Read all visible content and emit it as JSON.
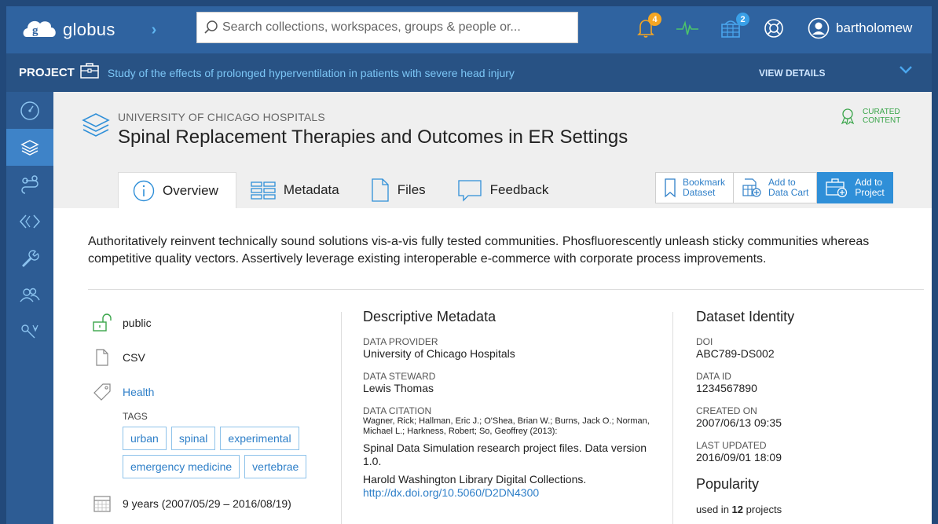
{
  "topbar": {
    "brand": "globus",
    "search_placeholder": "Search collections, workspaces, groups & people or...",
    "notifications_count": "4",
    "cart_count": "2",
    "username": "bartholomew"
  },
  "project": {
    "label": "PROJECT",
    "title": "Study of the effects of prolonged hyperventilation in patients with severe head injury",
    "view_details": "VIEW DETAILS"
  },
  "dataset": {
    "org": "UNIVERSITY OF CHICAGO HOSPITALS",
    "title": "Spinal Replacement Therapies and Outcomes in ER Settings",
    "curated_line1": "CURATED",
    "curated_line2": "CONTENT",
    "description": "Authoritatively reinvent technically sound solutions vis-a-vis fully tested communities. Phosfluorescently unleash sticky communities whereas competitive quality vectors. Assertively leverage existing interoperable e-commerce with corporate process improvements."
  },
  "tabs": [
    {
      "label": "Overview"
    },
    {
      "label": "Metadata"
    },
    {
      "label": "Files"
    },
    {
      "label": "Feedback"
    }
  ],
  "actions": {
    "bookmark_1": "Bookmark",
    "bookmark_2": "Dataset",
    "cart_1": "Add to",
    "cart_2": "Data Cart",
    "project_1": "Add to",
    "project_2": "Project"
  },
  "summary": {
    "access": "public",
    "format": "CSV",
    "category": "Health",
    "tags_label": "TAGS",
    "tags": [
      "urban",
      "spinal",
      "experimental",
      "emergency medicine",
      "vertebrae"
    ],
    "timespan": "9 years (2007/05/29 – 2016/08/19)"
  },
  "descriptive": {
    "heading": "Descriptive Metadata",
    "provider_label": "DATA PROVIDER",
    "provider": "University of Chicago Hospitals",
    "steward_label": "DATA STEWARD",
    "steward": "Lewis Thomas",
    "citation_label": "DATA CITATION",
    "citation_authors": "Wagner, Rick; Hallman, Eric J.; O'Shea, Brian W.; Burns, Jack O.; Norman, Michael L.; Harkness, Robert; So, Geoffrey (2013):",
    "citation_title": "Spinal Data Simulation research project files. Data version 1.0.",
    "citation_publisher": "Harold Washington Library Digital Collections.",
    "citation_url": "http://dx.doi.org/10.5060/D2DN4300"
  },
  "identity": {
    "heading": "Dataset Identity",
    "doi_label": "DOI",
    "doi": "ABC789-DS002",
    "id_label": "DATA ID",
    "id": "1234567890",
    "created_label": "CREATED ON",
    "created": "2007/06/13 09:35",
    "updated_label": "LAST UPDATED",
    "updated": "2016/09/01 18:09",
    "popularity_heading": "Popularity",
    "popularity_prefix": "used in",
    "popularity_count": "12",
    "popularity_suffix": "projects"
  },
  "icons": [
    "globus-logo-icon",
    "chevron-right-icon",
    "search-icon",
    "bell-icon",
    "activity-icon",
    "data-cart-icon",
    "help-icon",
    "user-icon",
    "briefcase-icon",
    "chevron-down-icon",
    "dashboard-icon",
    "layers-icon",
    "transfer-icon",
    "code-icon",
    "wrench-icon",
    "groups-icon",
    "admin-icon",
    "curated-icon",
    "info-icon",
    "metadata-icon",
    "file-icon",
    "feedback-icon",
    "bookmark-icon",
    "unlock-icon",
    "tag-icon",
    "calendar-icon"
  ]
}
